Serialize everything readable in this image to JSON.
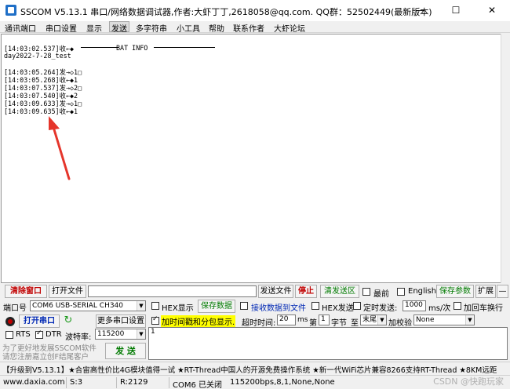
{
  "window": {
    "title": "SSCOM V5.13.1 串口/网络数据调试器,作者:大虾丁丁,2618058@qq.com. QQ群：52502449(最新版本)",
    "minimize": "—",
    "maximize": "☐",
    "close": "✕"
  },
  "menu": {
    "items": [
      "通讯端口",
      "串口设置",
      "显示",
      "发送",
      "多字符串",
      "小工具",
      "帮助",
      "联系作者",
      "大虾论坛"
    ]
  },
  "log": {
    "lines": [
      "[14:03:02.537]收←◆",
      "day2022-7-28_test",
      "",
      "[14:03:05.264]发→◇1□",
      "[14:03:05.268]收←◆1",
      "[14:03:07.537]发→◇2□",
      "[14:03:07.540]收←◆2",
      "[14:03:09.633]发→◇1□",
      "[14:03:09.635]收←◆1"
    ],
    "bat_info": "BAT INFO"
  },
  "toolbar": {
    "clear_window": "清除窗口",
    "open_file": "打开文件",
    "file_path": "",
    "send_file": "发送文件",
    "stop": "停止",
    "clear_send": "清发送区",
    "latest": "最前",
    "english": "English",
    "save_params": "保存参数",
    "expand": "扩展",
    "collapse": "—"
  },
  "config": {
    "port_label": "端口号",
    "port_value": "COM6 USB-SERIAL CH340",
    "hex_display": "HEX显示",
    "save_data": "保存数据",
    "recv_to_file": "接收数据到文件",
    "hex_send": "HEX发送",
    "timed_send": "定时发送:",
    "timed_interval": "1000",
    "timed_unit": "ms/次",
    "add_crlf": "加回车换行",
    "open_port": "打开串口",
    "more_settings": "更多串口设置",
    "timestamp_label": "加时间戳和分包显示.",
    "timeout_label": "超时时间:",
    "timeout_value": "20",
    "timeout_unit": "ms",
    "byte_prefix": "第",
    "byte_index": "1",
    "byte_label": "字节",
    "to_label": "至",
    "to_value": "末尾",
    "checksum_label": "加校验",
    "checksum_value": "None",
    "rts": "RTS",
    "dtr": "DTR",
    "baud_label": "波特率:",
    "baud_value": "115200",
    "send_text": "1",
    "promo_line1": "为了更好地发展SSCOM软件",
    "promo_line2": "请您注册嘉立创F结尾客户",
    "send": "发 送"
  },
  "ticker": {
    "text": "【升级到V5.13.1】★合宙高性价比4G模块值得一试 ★RT-Thread中国人的开源免费操作系统 ★新一代WiFi芯片兼容8266支持RT-Thread ★8KM远距"
  },
  "status": {
    "website": "www.daxia.com",
    "sent": "S:3",
    "received": "R:2129",
    "port_state": "COM6 已关闭",
    "port_params": "115200bps,8,1,None,None",
    "watermark": "CSDN @快跑玩家"
  },
  "colors": {
    "accent_red": "#c00000",
    "accent_green": "#007a00",
    "arrow": "#e5352b",
    "highlight": "#ffff00"
  }
}
